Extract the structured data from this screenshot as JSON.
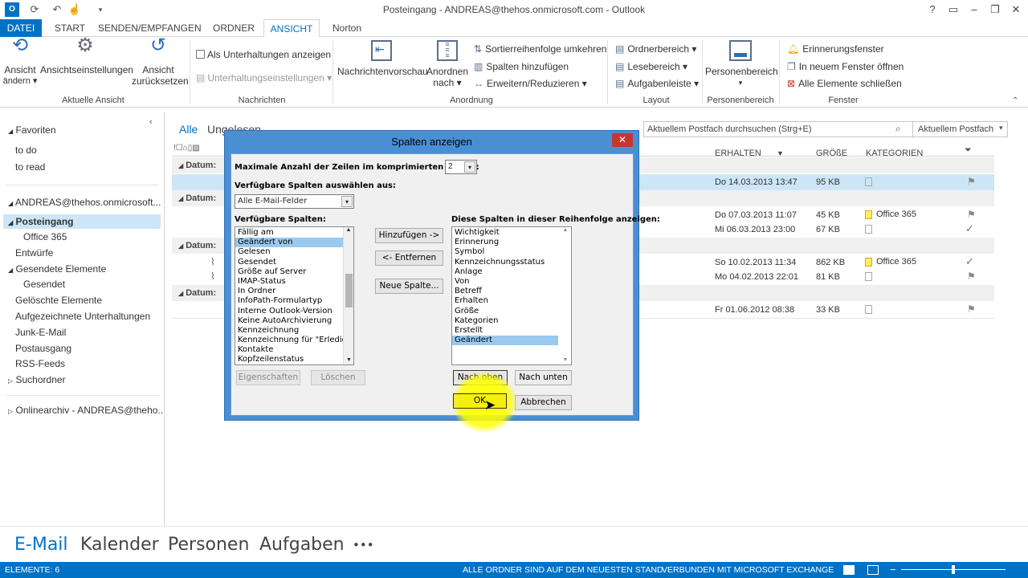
{
  "window": {
    "title": "Posteingang - ANDREAS@thehos.onmicrosoft.com - Outlook"
  },
  "tabs": [
    "DATEI",
    "START",
    "SENDEN/EMPFANGEN",
    "ORDNER",
    "ANSICHT",
    "Norton"
  ],
  "ribbon": {
    "aktuelle_ansicht": {
      "btn1": "Ansicht",
      "btn1b": "ändern ▾",
      "btn2": "Ansichtseinstellungen",
      "btn3": "Ansicht",
      "btn3b": "zurücksetzen",
      "label": "Aktuelle Ansicht"
    },
    "nachrichten": {
      "check": "Als Unterhaltungen anzeigen",
      "conv": "Unterhaltungseinstellungen ▾",
      "label": "Nachrichten"
    },
    "anordnung": {
      "vorschau": "Nachrichtenvorschau",
      "anordnen": "Anordnen",
      "anordnen_b": "nach ▾",
      "sort": "Sortierreihenfolge umkehren",
      "spalten": "Spalten hinzufügen",
      "erweitern": "Erweitern/Reduzieren ▾",
      "label": "Anordnung"
    },
    "layout": {
      "ordner": "Ordnerbereich ▾",
      "lese": "Lesebereich ▾",
      "aufgaben": "Aufgabenleiste ▾",
      "label": "Layout"
    },
    "personen": {
      "btn": "Personenbereich",
      "label": "Personenbereich"
    },
    "fenster": {
      "erinnerung": "Erinnerungsfenster",
      "neu": "In neuem Fenster öffnen",
      "alle": "Alle Elemente schließen",
      "label": "Fenster"
    }
  },
  "nav": {
    "favoriten": "Favoriten",
    "todo": "to do",
    "toread": "to read",
    "account": "ANDREAS@thehos.onmicrosoft...",
    "posteingang": "Posteingang",
    "office365": "Office 365",
    "entwuerfe": "Entwürfe",
    "gesendete": "Gesendete Elemente",
    "gesendet": "Gesendet",
    "geloeschte": "Gelöschte Elemente",
    "aufgezeichnete": "Aufgezeichnete Unterhaltungen",
    "junk": "Junk-E-Mail",
    "postausgang": "Postausgang",
    "rss": "RSS-Feeds",
    "such": "Suchordner",
    "online": "Onlinearchiv - ANDREAS@theho..."
  },
  "list": {
    "filter_all": "Alle",
    "filter_unread": "Ungelesen",
    "search_placeholder": "Aktuellem Postfach durchsuchen (Strg+E)",
    "scope": "Aktuellem Postfach",
    "col_received": "ERHALTEN",
    "col_size": "GRÖßE",
    "col_cat": "KATEGORIEN",
    "group_label": "Datum:",
    "rows": [
      {
        "date": "Do 14.03.2013 13:47",
        "size": "95 KB",
        "cat": ""
      },
      {
        "date": "Do 07.03.2013 11:07",
        "size": "45 KB",
        "cat": "Office 365"
      },
      {
        "date": "Mi 06.03.2013 23:00",
        "size": "67 KB",
        "cat": ""
      },
      {
        "date": "So 10.02.2013 11:34",
        "size": "862 KB",
        "cat": "Office 365"
      },
      {
        "date": "Mo 04.02.2013 22:01",
        "size": "81 KB",
        "cat": ""
      },
      {
        "date": "Fr 01.06.2012 08:38",
        "size": "33 KB",
        "cat": ""
      }
    ]
  },
  "dialog": {
    "title": "Spalten anzeigen",
    "max_rows_label": "Maximale Anzahl der Zeilen im komprimierten Modus:",
    "max_rows_value": "2",
    "select_from_label": "Verfügbare Spalten auswählen aus:",
    "select_from_value": "Alle E-Mail-Felder",
    "available_label": "Verfügbare Spalten:",
    "available": [
      "Fällig am",
      "Geändert von",
      "Gelesen",
      "Gesendet",
      "Größe auf Server",
      "IMAP-Status",
      "In Ordner",
      "InfoPath-Formulartyp",
      "Interne Outlook-Version",
      "Keine AutoArchivierung",
      "Kennzeichnung",
      "Kennzeichnung für \"Erledig",
      "Kontakte",
      "Kopfzeilenstatus"
    ],
    "shown_label": "Diese Spalten in dieser Reihenfolge anzeigen:",
    "shown": [
      "Wichtigkeit",
      "Erinnerung",
      "Symbol",
      "Kennzeichnungsstatus",
      "Anlage",
      "Von",
      "Betreff",
      "Erhalten",
      "Größe",
      "Kategorien",
      "Erstellt",
      "Geändert"
    ],
    "btn_add": "Hinzufügen ->",
    "btn_remove": "<- Entfernen",
    "btn_new": "Neue Spalte...",
    "btn_props": "Eigenschaften",
    "btn_delete": "Löschen",
    "btn_up": "Nach oben",
    "btn_down": "Nach unten",
    "btn_ok": "OK",
    "btn_cancel": "Abbrechen"
  },
  "bottom": {
    "mail": "E-Mail",
    "calendar": "Kalender",
    "people": "Personen",
    "tasks": "Aufgaben",
    "more": "•••"
  },
  "status": {
    "items": "ELEMENTE: 6",
    "folders": "ALLE ORDNER SIND AUF DEM NEUESTEN STAND.",
    "connected": "VERBUNDEN MIT MICROSOFT EXCHANGE"
  }
}
